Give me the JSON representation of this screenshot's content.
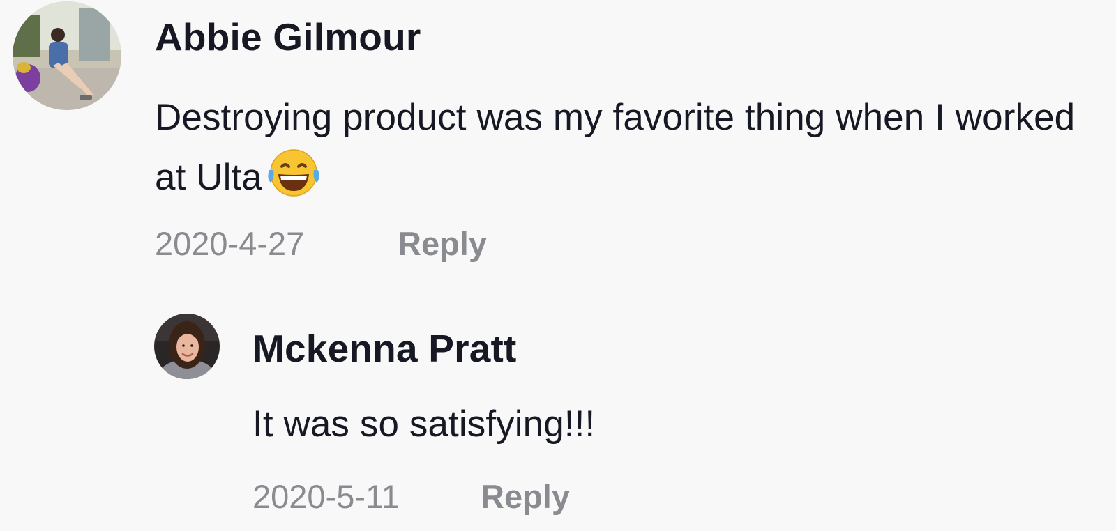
{
  "comments": [
    {
      "username": "Abbie Gilmour",
      "text": "Destroying product was my favorite thing when I worked at Ulta",
      "emoji": "face-with-tears-of-joy",
      "date": "2020-4-27",
      "reply_label": "Reply",
      "replies": [
        {
          "username": "Mckenna Pratt",
          "text": "It was so satisfying!!!",
          "date": "2020-5-11",
          "reply_label": "Reply"
        }
      ]
    }
  ],
  "colors": {
    "background": "#f8f8f8",
    "text_primary": "#161823",
    "text_secondary": "#8a8b91"
  }
}
